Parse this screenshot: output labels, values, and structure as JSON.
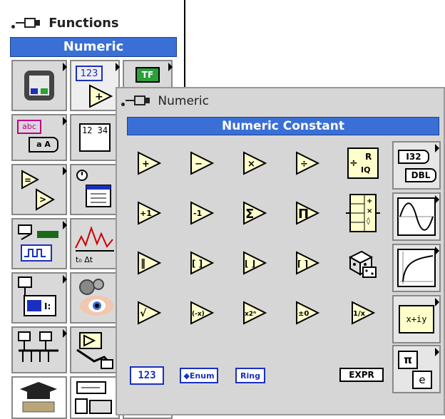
{
  "functions_palette": {
    "title": "Functions",
    "subpalette_title": "Numeric",
    "cells": [
      {
        "icon": "cluster-icon"
      },
      {
        "icon": "numeric-123-icon",
        "text": "123"
      },
      {
        "icon": "boolean-tf-icon",
        "text": "TF"
      },
      {
        "icon": "string-abc-icon",
        "text": "abc"
      },
      {
        "icon": "array-icon",
        "text": "12 34"
      },
      {
        "icon": "comparison-icon"
      },
      {
        "icon": "timing-icon"
      },
      {
        "icon": "waveform-icon"
      },
      {
        "icon": "io-icon"
      },
      {
        "icon": "instrument-icon"
      },
      {
        "icon": "vision-icon"
      },
      {
        "icon": "graphics-icon"
      },
      {
        "icon": "tutorial-icon"
      },
      {
        "icon": "report-icon"
      }
    ]
  },
  "numeric_palette": {
    "title": "Numeric",
    "header": "Numeric Constant",
    "functions": [
      {
        "name": "add",
        "glyph": "+"
      },
      {
        "name": "subtract",
        "glyph": "−"
      },
      {
        "name": "multiply",
        "glyph": "×"
      },
      {
        "name": "divide",
        "glyph": "÷"
      },
      {
        "name": "increment",
        "glyph": "+1"
      },
      {
        "name": "decrement",
        "glyph": "-1"
      },
      {
        "name": "add-array-elements",
        "glyph": "Σ"
      },
      {
        "name": "multiply-array-elements",
        "glyph": "Π"
      },
      {
        "name": "absolute-value",
        "glyph": "‖"
      },
      {
        "name": "round-nearest",
        "glyph": "[ ]"
      },
      {
        "name": "round-down",
        "glyph": "⌊ ⌋"
      },
      {
        "name": "round-up",
        "glyph": "⌈ ⌉"
      },
      {
        "name": "square-root",
        "glyph": "√"
      },
      {
        "name": "negate",
        "glyph": "(-x)"
      },
      {
        "name": "scale-power-of-2",
        "glyph": "x2ⁿ"
      },
      {
        "name": "sign",
        "glyph": "±0"
      },
      {
        "name": "reciprocal",
        "glyph": "1/x"
      }
    ],
    "quotient_remainder": {
      "top": "R",
      "bottom": "IQ"
    },
    "compound_arithmetic_ops": "+ × ◊",
    "random_number_icon": "dice-icon",
    "conversion": {
      "top": "I32",
      "bottom": "DBL"
    },
    "complex": "x+iy",
    "constants": {
      "pi": "π",
      "e": "e"
    },
    "numeric_constant_label": "123",
    "enum_label": "◆Enum",
    "ring_label": "Ring",
    "expression_label": "EXPR"
  },
  "colors": {
    "title_bar": "#3a6fd6",
    "node_fill": "#ffffcc",
    "node_border": "#000000",
    "constant_blue": "#1a2fbf"
  }
}
